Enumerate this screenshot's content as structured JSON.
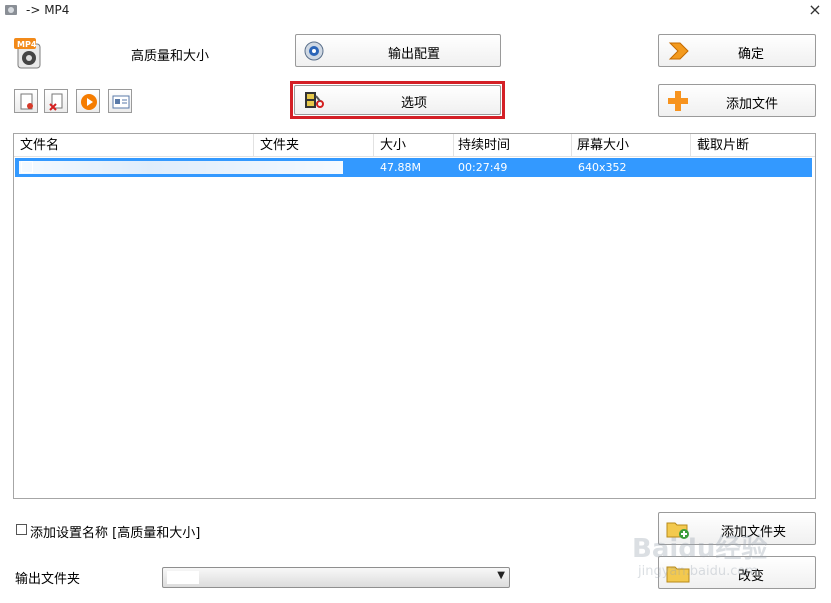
{
  "window": {
    "title": "-> MP4"
  },
  "preset": {
    "label": "高质量和大小"
  },
  "buttons": {
    "output_config": "输出配置",
    "ok": "确定",
    "options": "选项",
    "add_file": "添加文件",
    "add_folder": "添加文件夹",
    "change": "改变"
  },
  "toolbar": {
    "icons": [
      "new-file-icon",
      "delete-file-icon",
      "play-icon",
      "media-info-icon"
    ]
  },
  "file_list": {
    "columns": [
      "文件名",
      "文件夹",
      "大小",
      "持续时间",
      "屏幕大小",
      "截取片断"
    ],
    "rows": [
      {
        "name": "",
        "folder": "",
        "size": "47.88M",
        "duration": "00:27:49",
        "screen_size": "640x352",
        "clip": ""
      }
    ]
  },
  "bottom": {
    "add_name_label": "添加设置名称 [高质量和大小]",
    "output_folder_label": "输出文件夹",
    "output_folder_value": ""
  },
  "watermark": {
    "text": "Baidu经验",
    "sub": "jingyan.baidu.com"
  },
  "colors": {
    "selection": "#3399ff",
    "highlight": "#d42026",
    "accent_orange": "#f57c00"
  }
}
